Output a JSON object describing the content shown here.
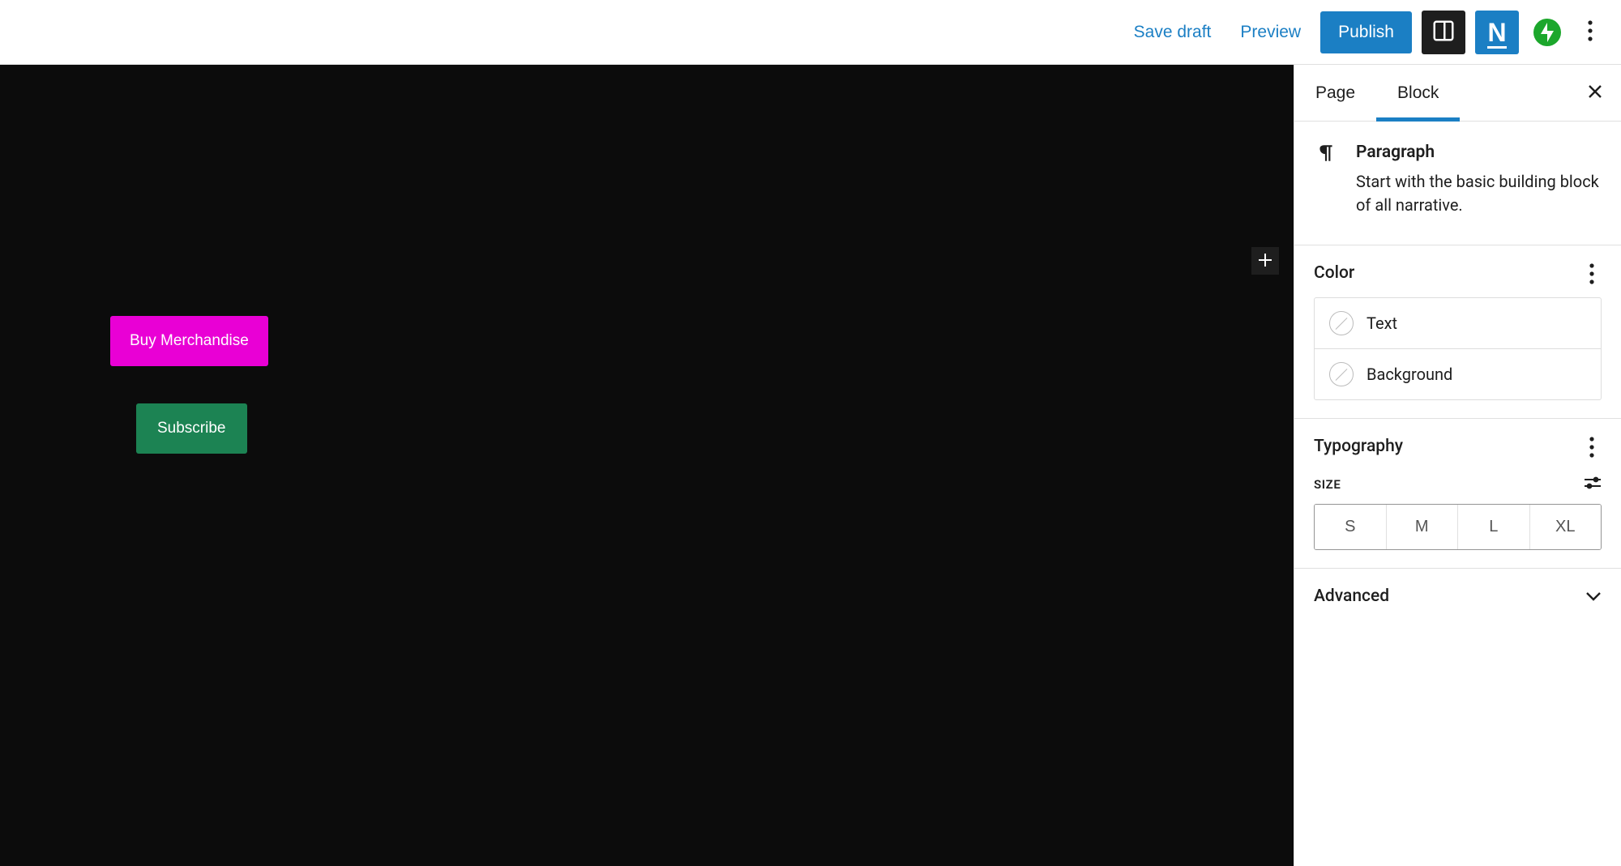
{
  "toolbar": {
    "save_draft": "Save draft",
    "preview": "Preview",
    "publish": "Publish"
  },
  "canvas": {
    "buy_merchandise": "Buy Merchandise",
    "subscribe": "Subscribe"
  },
  "sidebar": {
    "tabs": {
      "page": "Page",
      "block": "Block"
    },
    "active_tab": "Block",
    "block_info": {
      "title": "Paragraph",
      "description": "Start with the basic building block of all narrative."
    },
    "sections": {
      "color": {
        "title": "Color",
        "items": {
          "text": "Text",
          "background": "Background"
        }
      },
      "typography": {
        "title": "Typography",
        "size_label": "SIZE",
        "sizes": [
          "S",
          "M",
          "L",
          "XL"
        ]
      },
      "advanced": {
        "title": "Advanced"
      }
    }
  }
}
